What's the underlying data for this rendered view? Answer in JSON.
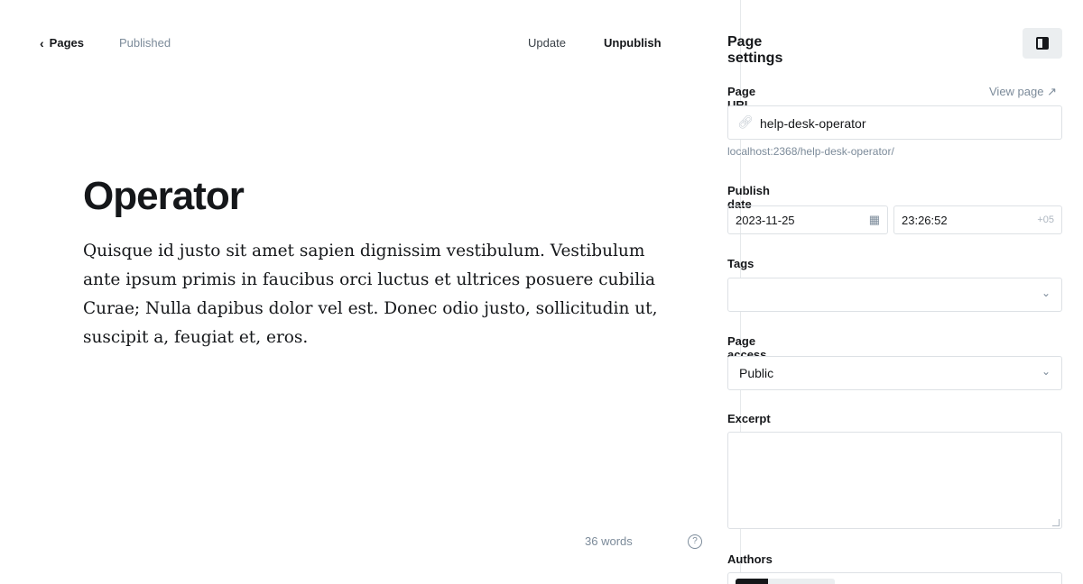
{
  "topbar": {
    "back_label": "Pages",
    "status": "Published",
    "update_label": "Update",
    "unpublish_label": "Unpublish"
  },
  "post": {
    "title": "Operator",
    "paragraphs": [
      "Quisque id justo sit amet sapien dignissim vestibulum. Vestibulum ante ipsum primis in faucibus orci luctus et ultrices posuere cubilia Curae; Nulla dapibus dolor vel est. Donec odio justo, sollicitudin ut, suscipit a, feugiat et, eros."
    ]
  },
  "footer": {
    "word_count": "36 words",
    "help_icon": "?"
  },
  "sidebar": {
    "title": "Page settings",
    "toggle_icon": "sidebar-toggle-icon",
    "url_label": "Page URL",
    "view_page": "View page ↗",
    "slug": "help-desk-operator",
    "url_preview": "localhost:2368/help-desk-operator/",
    "publish_date_label": "Publish date",
    "date": "2023-11-25",
    "time": "23:26:52",
    "timezone": "+05",
    "tags_label": "Tags",
    "tags_value": "",
    "access_label": "Page access",
    "access_value": "Public",
    "excerpt_label": "Excerpt",
    "authors_label": "Authors"
  },
  "colors": {
    "text": "#15171a",
    "muted": "#7c8b9a",
    "border": "#dde1e5",
    "toggle_bg": "#ebeef0"
  }
}
